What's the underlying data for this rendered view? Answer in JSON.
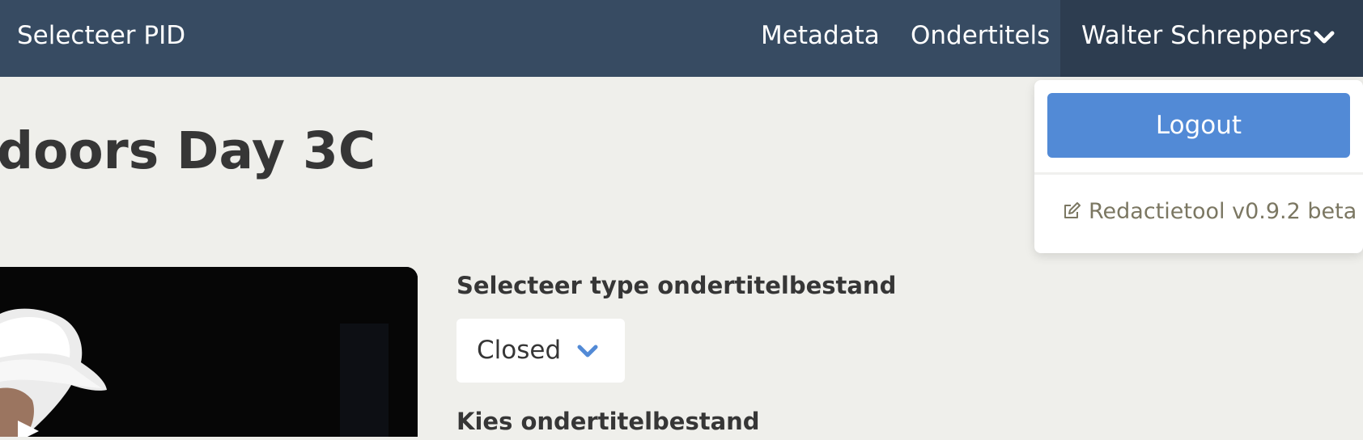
{
  "navbar": {
    "brand": "Selecteer PID",
    "items": [
      {
        "label": "Metadata"
      },
      {
        "label": "Ondertitels"
      }
    ],
    "user": {
      "name": "Walter Schreppers",
      "icon": "chevron-down-icon"
    },
    "background": "#374b62"
  },
  "page": {
    "title": "doors Day 3C"
  },
  "form": {
    "type_label": "Selecteer type ondertitelbestand",
    "type_select": {
      "value": "Closed",
      "icon": "chevron-down-icon"
    },
    "file_label": "Kies ondertitelbestand"
  },
  "user_menu": {
    "logout_label": "Logout",
    "version_label": "Redactietool v0.9.2 beta",
    "version_icon": "edit-icon",
    "accent": "#528ad6"
  }
}
